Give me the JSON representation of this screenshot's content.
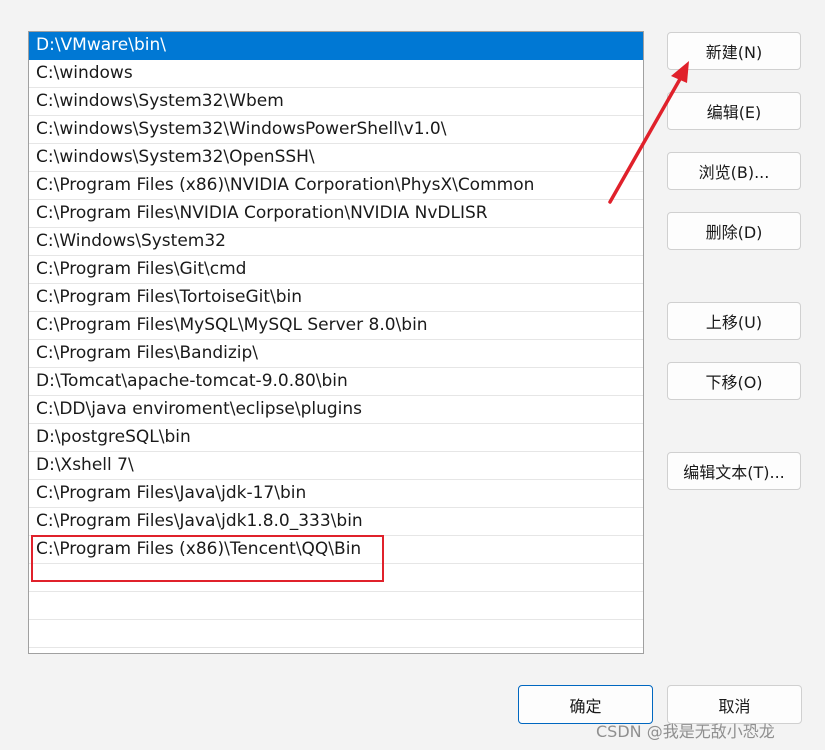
{
  "path_list": {
    "items": [
      "D:\\VMware\\bin\\",
      "C:\\windows",
      "C:\\windows\\System32\\Wbem",
      "C:\\windows\\System32\\WindowsPowerShell\\v1.0\\",
      "C:\\windows\\System32\\OpenSSH\\",
      "C:\\Program Files (x86)\\NVIDIA Corporation\\PhysX\\Common",
      "C:\\Program Files\\NVIDIA Corporation\\NVIDIA NvDLISR",
      "C:\\Windows\\System32",
      "C:\\Program Files\\Git\\cmd",
      "C:\\Program Files\\TortoiseGit\\bin",
      "C:\\Program Files\\MySQL\\MySQL Server 8.0\\bin",
      "C:\\Program Files\\Bandizip\\",
      "D:\\Tomcat\\apache-tomcat-9.0.80\\bin",
      "C:\\DD\\java enviroment\\eclipse\\plugins",
      "D:\\postgreSQL\\bin",
      "D:\\Xshell 7\\",
      "C:\\Program Files\\Java\\jdk-17\\bin",
      "C:\\Program Files\\Java\\jdk1.8.0_333\\bin",
      "C:\\Program Files (x86)\\Tencent\\QQ\\Bin",
      "",
      "",
      ""
    ],
    "selected_index": 0
  },
  "buttons": {
    "new": "新建(N)",
    "edit": "编辑(E)",
    "browse": "浏览(B)...",
    "delete": "删除(D)",
    "move_up": "上移(U)",
    "move_down": "下移(O)",
    "edit_text": "编辑文本(T)...",
    "ok": "确定",
    "cancel": "取消"
  },
  "watermark": "CSDN @我是无敌小恐龙",
  "colors": {
    "selection": "#0078d4",
    "annotation_red": "#e0212b"
  }
}
